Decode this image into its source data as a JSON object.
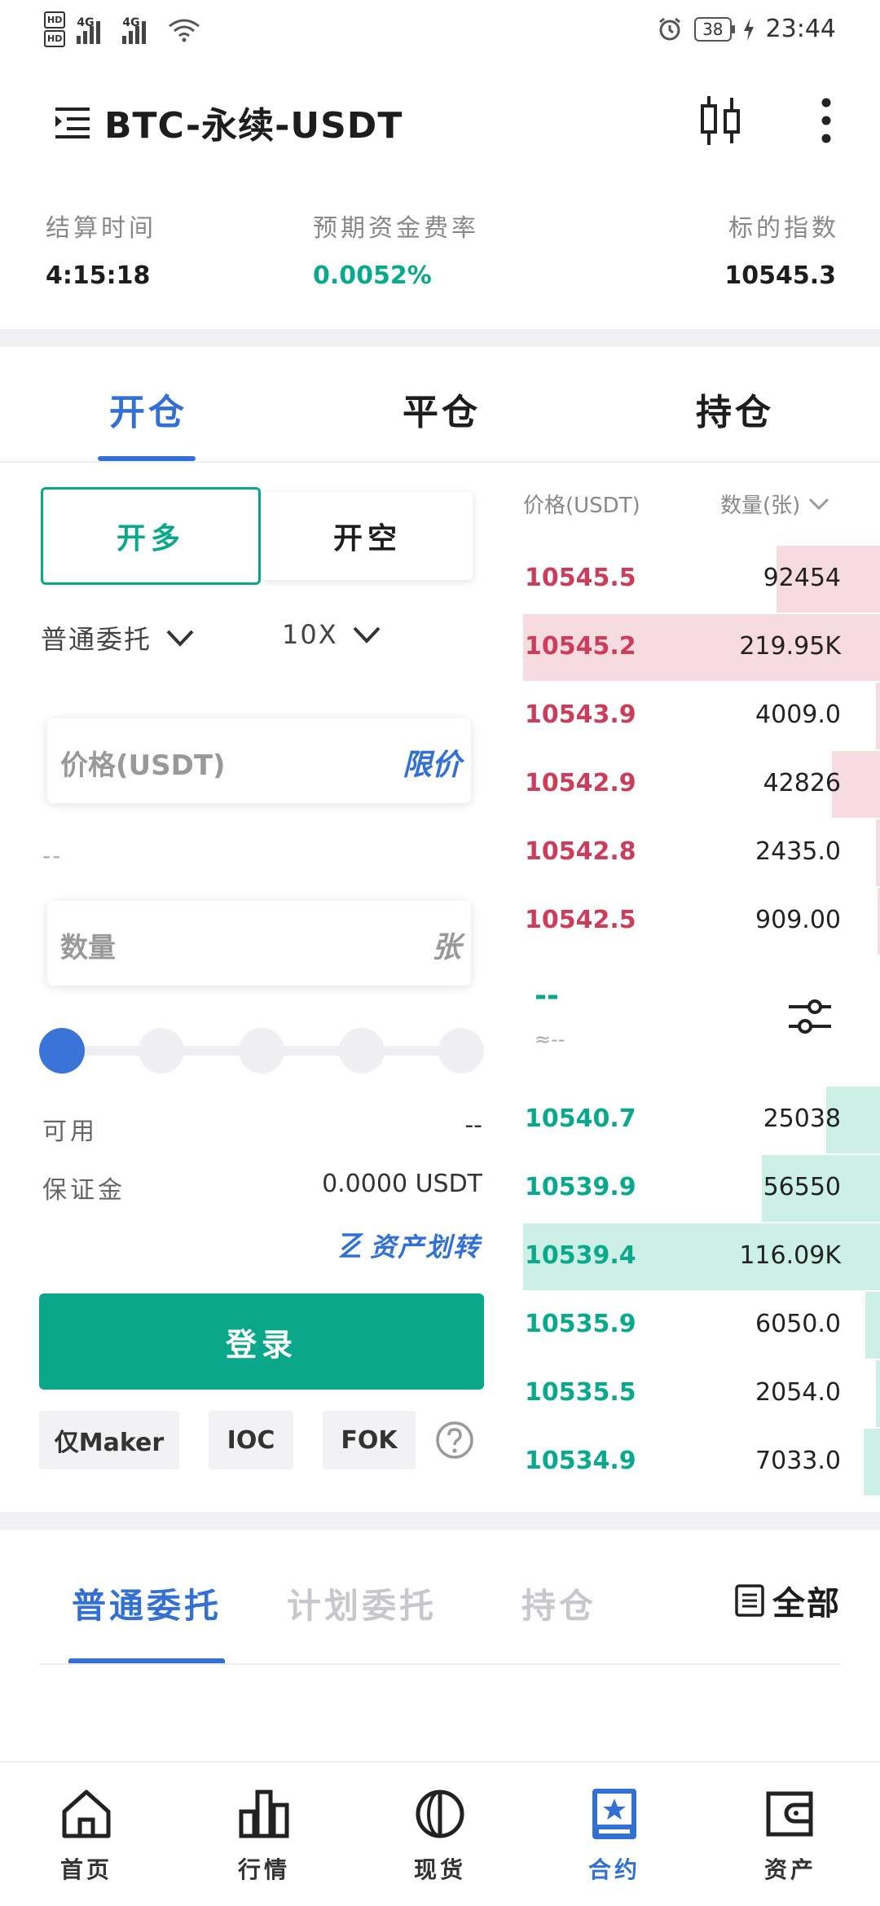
{
  "status_bar": {
    "hd1": "HD",
    "hd2": "HD",
    "net1": "4G",
    "net2": "4G",
    "battery": "38",
    "time": "23:44"
  },
  "header": {
    "title": "BTC-永续-USDT"
  },
  "info": {
    "settle_label": "结算时间",
    "settle_value": "4:15:18",
    "funding_label": "预期资金费率",
    "funding_value": "0.0052%",
    "index_label": "标的指数",
    "index_value": "10545.3"
  },
  "tabs": [
    "开仓",
    "平仓",
    "持仓"
  ],
  "form": {
    "long_label": "开多",
    "short_label": "开空",
    "order_type": "普通委托",
    "leverage": "10X",
    "price_placeholder": "价格(USDT)",
    "price_suffix": "限价",
    "price_hint": "--",
    "qty_placeholder": "数量",
    "qty_suffix": "张",
    "available_label": "可用",
    "available_value": "--",
    "margin_label": "保证金",
    "margin_value": "0.0000 USDT",
    "transfer_label": "资产划转",
    "login_label": "登录",
    "options": [
      "仅Maker",
      "IOC",
      "FOK"
    ]
  },
  "orderbook": {
    "price_header": "价格(USDT)",
    "qty_header": "数量(张)",
    "asks": [
      {
        "price": "10545.5",
        "qty": "92454",
        "depth": 0.29
      },
      {
        "price": "10545.2",
        "qty": "219.95K",
        "depth": 1.0
      },
      {
        "price": "10543.9",
        "qty": "4009.0",
        "depth": 0.012
      },
      {
        "price": "10542.9",
        "qty": "42826",
        "depth": 0.135
      },
      {
        "price": "10542.8",
        "qty": "2435.0",
        "depth": 0.012
      },
      {
        "price": "10542.5",
        "qty": "909.00",
        "depth": 0.006
      }
    ],
    "mid_price": "--",
    "mid_sub": "≈--",
    "bids": [
      {
        "price": "10540.7",
        "qty": "25038",
        "depth": 0.15
      },
      {
        "price": "10539.9",
        "qty": "56550",
        "depth": 0.33
      },
      {
        "price": "10539.4",
        "qty": "116.09K",
        "depth": 1.0
      },
      {
        "price": "10535.9",
        "qty": "6050.0",
        "depth": 0.04
      },
      {
        "price": "10535.5",
        "qty": "2054.0",
        "depth": 0.012
      },
      {
        "price": "10534.9",
        "qty": "7033.0",
        "depth": 0.045
      }
    ]
  },
  "order_tabs": [
    "普通委托",
    "计划委托",
    "持仓"
  ],
  "order_all": "全部",
  "bottom_nav": [
    "首页",
    "行情",
    "现货",
    "合约",
    "资产"
  ],
  "colors": {
    "accent": "#3270d6",
    "buy": "#0aa78a",
    "sell": "#cc3d5c"
  }
}
